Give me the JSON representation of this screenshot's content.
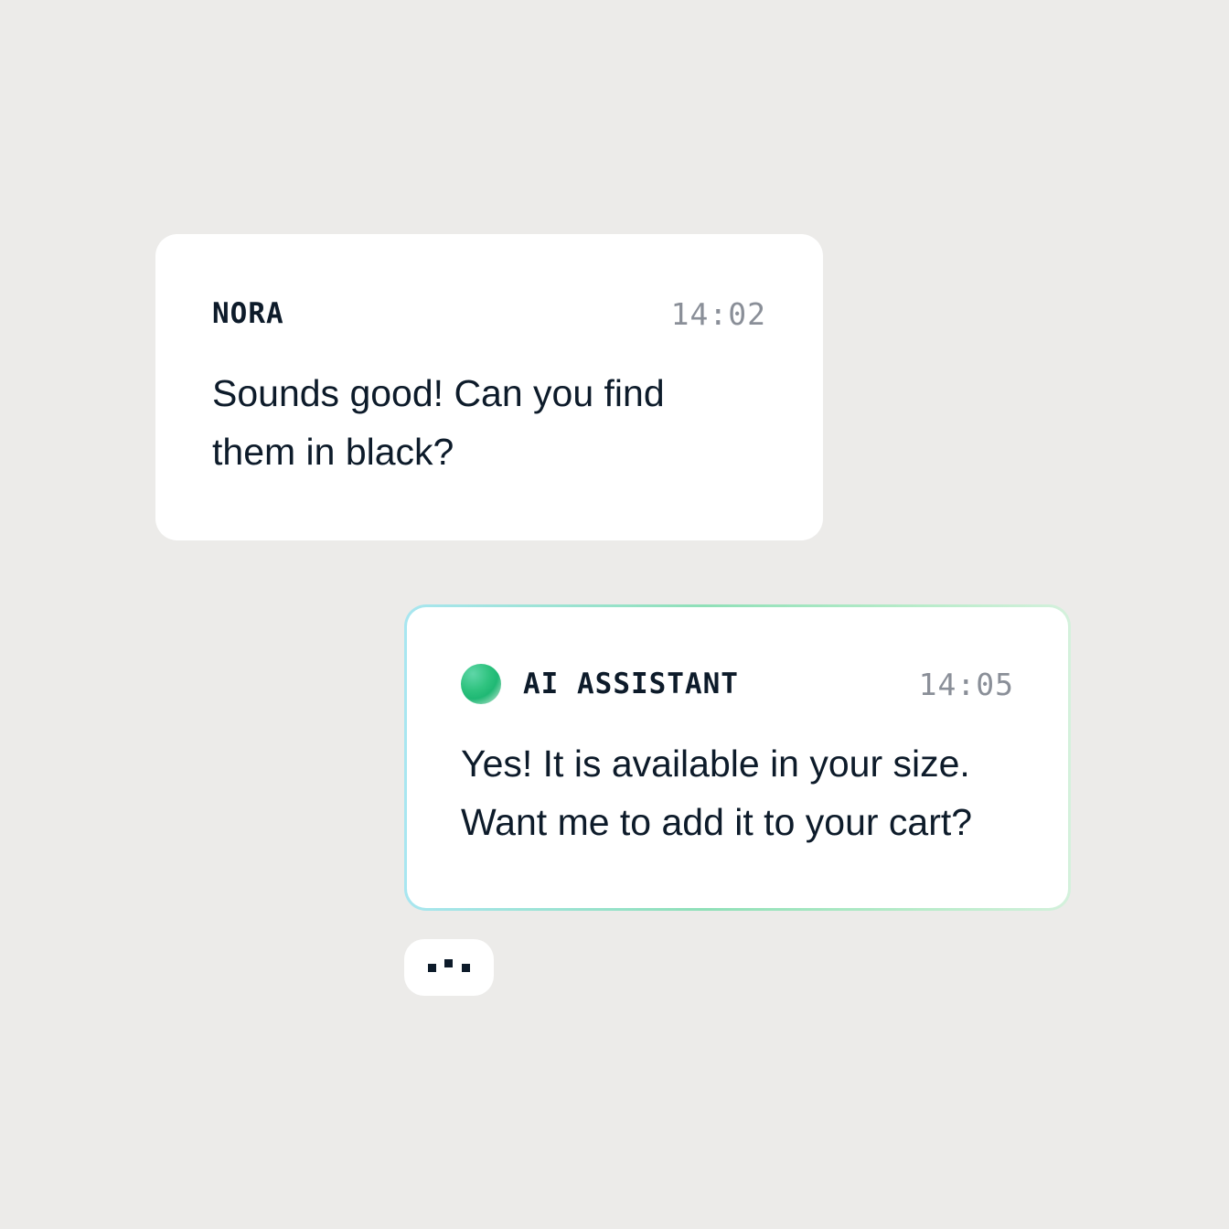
{
  "conversation": {
    "messages": [
      {
        "sender": "NORA",
        "time": "14:02",
        "text": "Sounds good! Can you find\nthem in black?"
      },
      {
        "sender": "AI ASSISTANT",
        "time": "14:05",
        "text": "Yes! It is available in your size.\nWant me to add it to your cart?"
      }
    ],
    "typing_indicator": true
  },
  "colors": {
    "background": "#ECEBE9",
    "bubble": "#FFFFFF",
    "text": "#0D1B2A",
    "timestamp": "#8A8F98",
    "ai_accent": "#2FC37F"
  }
}
